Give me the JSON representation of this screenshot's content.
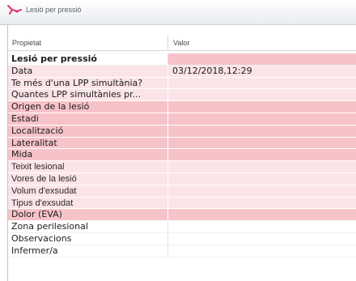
{
  "window": {
    "title": "Lesió per pressió",
    "icon": "app-logo-icon"
  },
  "grid": {
    "columns": [
      "Propietat",
      "Valor"
    ],
    "rows": [
      {
        "prop": "Lesió per pressió",
        "value": "",
        "style": "bold",
        "bg": "white",
        "valbg": "pink"
      },
      {
        "prop": "Data",
        "value": "03/12/2018,12:29",
        "style": "normal",
        "bg": "light",
        "valbg": "light"
      },
      {
        "prop": "Te més d'una LPP simultània?",
        "value": "",
        "style": "normal",
        "bg": "light",
        "valbg": "light"
      },
      {
        "prop": "Quantes LPP simultànies pr...",
        "value": "",
        "style": "normal",
        "bg": "light",
        "valbg": "light"
      },
      {
        "prop": "Origen de la lesió",
        "value": "",
        "style": "normal",
        "bg": "pink",
        "valbg": "pink"
      },
      {
        "prop": "Estadi",
        "value": "",
        "style": "normal",
        "bg": "pink",
        "valbg": "pink"
      },
      {
        "prop": "Localització",
        "value": "",
        "style": "normal",
        "bg": "pink",
        "valbg": "pink"
      },
      {
        "prop": "Lateralitat",
        "value": "",
        "style": "normal",
        "bg": "pink",
        "valbg": "pink"
      },
      {
        "prop": "Mida",
        "value": "",
        "style": "normal",
        "bg": "pink",
        "valbg": "pink"
      },
      {
        "prop": "Teixit lesional",
        "value": "",
        "style": "thin",
        "bg": "light",
        "valbg": "light"
      },
      {
        "prop": "Vores de la lesió",
        "value": "",
        "style": "thin",
        "bg": "light",
        "valbg": "light"
      },
      {
        "prop": "Volum d'exsudat",
        "value": "",
        "style": "thin",
        "bg": "light",
        "valbg": "light"
      },
      {
        "prop": "Tipus d'exsudat",
        "value": "",
        "style": "thin",
        "bg": "light",
        "valbg": "light"
      },
      {
        "prop": "Dolor (EVA)",
        "value": "",
        "style": "normal",
        "bg": "pink",
        "valbg": "pink"
      },
      {
        "prop": "Zona perilesional",
        "value": "",
        "style": "normal",
        "bg": "white",
        "valbg": "white"
      },
      {
        "prop": "Observacions",
        "value": "",
        "style": "normal",
        "bg": "white",
        "valbg": "white"
      },
      {
        "prop": "Infermer/a",
        "value": "",
        "style": "normal",
        "bg": "white",
        "valbg": "white"
      }
    ]
  },
  "colors": {
    "pink": "#f6c3c8",
    "light": "#fbe4e7",
    "white": "#ffffff",
    "icon": "#e0336b"
  }
}
